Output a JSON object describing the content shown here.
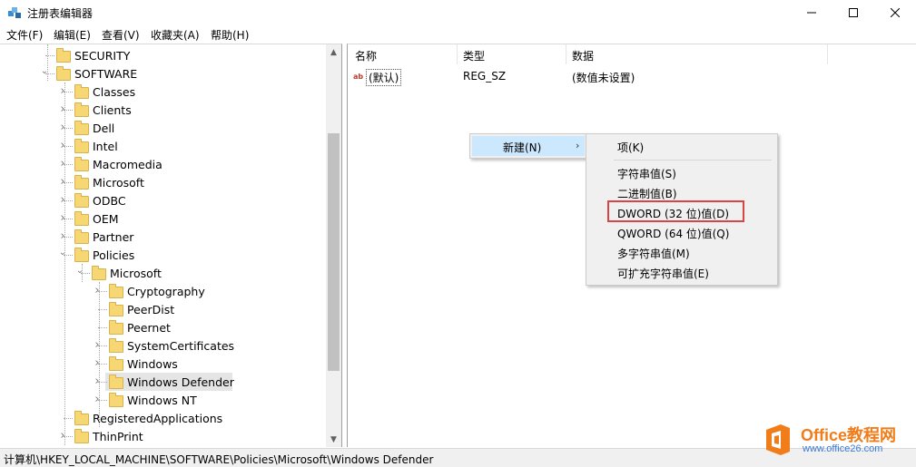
{
  "window": {
    "title": "注册表编辑器",
    "icon": "regedit-icon"
  },
  "menu": [
    "文件(F)",
    "编辑(E)",
    "查看(V)",
    "收藏夹(A)",
    "帮助(H)"
  ],
  "tree": {
    "items": [
      {
        "label": "SECURITY",
        "level": 1,
        "expander": "none"
      },
      {
        "label": "SOFTWARE",
        "level": 1,
        "expander": "expanded"
      },
      {
        "label": "Classes",
        "level": 2,
        "expander": "collapsed"
      },
      {
        "label": "Clients",
        "level": 2,
        "expander": "collapsed"
      },
      {
        "label": "Dell",
        "level": 2,
        "expander": "collapsed"
      },
      {
        "label": "Intel",
        "level": 2,
        "expander": "collapsed"
      },
      {
        "label": "Macromedia",
        "level": 2,
        "expander": "collapsed"
      },
      {
        "label": "Microsoft",
        "level": 2,
        "expander": "collapsed"
      },
      {
        "label": "ODBC",
        "level": 2,
        "expander": "collapsed"
      },
      {
        "label": "OEM",
        "level": 2,
        "expander": "collapsed"
      },
      {
        "label": "Partner",
        "level": 2,
        "expander": "collapsed"
      },
      {
        "label": "Policies",
        "level": 2,
        "expander": "expanded"
      },
      {
        "label": "Microsoft",
        "level": 3,
        "expander": "expanded"
      },
      {
        "label": "Cryptography",
        "level": 4,
        "expander": "collapsed"
      },
      {
        "label": "PeerDist",
        "level": 4,
        "expander": "none"
      },
      {
        "label": "Peernet",
        "level": 4,
        "expander": "none"
      },
      {
        "label": "SystemCertificates",
        "level": 4,
        "expander": "collapsed"
      },
      {
        "label": "Windows",
        "level": 4,
        "expander": "collapsed"
      },
      {
        "label": "Windows Defender",
        "level": 4,
        "expander": "collapsed",
        "selected": true
      },
      {
        "label": "Windows NT",
        "level": 4,
        "expander": "collapsed"
      },
      {
        "label": "RegisteredApplications",
        "level": 2,
        "expander": "none"
      },
      {
        "label": "ThinPrint",
        "level": 2,
        "expander": "collapsed"
      }
    ]
  },
  "values_pane": {
    "columns": [
      "名称",
      "类型",
      "数据"
    ],
    "rows": [
      {
        "name": "(默认)",
        "type": "REG_SZ",
        "data": "(数值未设置)",
        "icon": "string-value-icon"
      }
    ]
  },
  "context_menu": {
    "new_label": "新建(N)",
    "arrow": "›"
  },
  "submenu": {
    "items": [
      "项(K)",
      "字符串值(S)",
      "二进制值(B)",
      "DWORD (32 位)值(D)",
      "QWORD (64 位)值(Q)",
      "多字符串值(M)",
      "可扩充字符串值(E)"
    ],
    "highlighted_index": 3,
    "highlight_color": "#d94444"
  },
  "status_bar": {
    "path": "计算机\\HKEY_LOCAL_MACHINE\\SOFTWARE\\Policies\\Microsoft\\Windows Defender"
  },
  "watermark": {
    "title": "Office教程网",
    "url": "www.office26.com"
  }
}
